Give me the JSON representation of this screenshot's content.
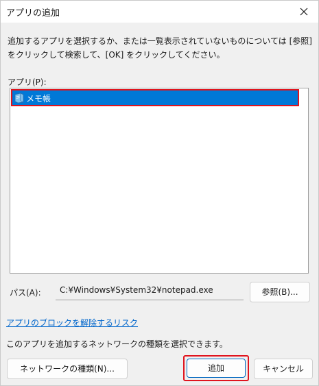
{
  "window": {
    "title": "アプリの追加",
    "close_icon": "close-icon"
  },
  "instruction": "追加するアプリを選択するか、または一覧表示されていないものについては [参照] をクリックして検索して、[OK] をクリックしてください。",
  "apps": {
    "label": "アプリ(P):",
    "items": [
      {
        "name": "メモ帳",
        "icon": "notepad-icon",
        "selected": true
      }
    ]
  },
  "path": {
    "label": "パス(A):",
    "value": "C:¥Windows¥System32¥notepad.exe"
  },
  "buttons": {
    "browse": "参照(B)...",
    "network_types": "ネットワークの種類(N)...",
    "add": "追加",
    "cancel": "キャンセル"
  },
  "links": {
    "block_risk": "アプリのブロックを解除するリスク"
  },
  "network_description": "このアプリを追加するネットワークの種類を選択できます。",
  "colors": {
    "selection": "#0078d7",
    "highlight_border": "#e0141e",
    "link": "#0066cc",
    "dialog_background": "#f0f0f0"
  }
}
